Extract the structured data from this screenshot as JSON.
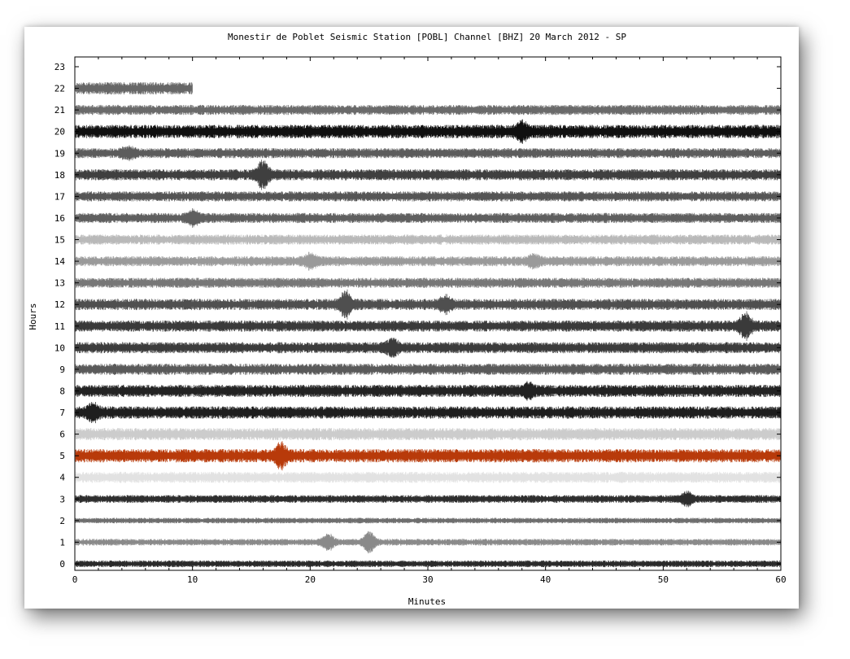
{
  "chart_data": {
    "type": "line",
    "title": "Monestir de Poblet Seismic Station [POBL] Channel [BHZ] 20 March 2012 - SP",
    "xlabel": "Minutes",
    "ylabel": "Hours",
    "xlim": [
      0,
      60
    ],
    "ylim": [
      0,
      23
    ],
    "x_ticks": [
      "0",
      "10",
      "20",
      "30",
      "40",
      "50",
      "60"
    ],
    "y_ticks": [
      "0",
      "1",
      "2",
      "3",
      "4",
      "5",
      "6",
      "7",
      "8",
      "9",
      "10",
      "11",
      "12",
      "13",
      "14",
      "15",
      "16",
      "17",
      "18",
      "19",
      "20",
      "21",
      "22",
      "23"
    ],
    "grid": false,
    "series": [
      {
        "hour": 0,
        "color": "#2a2a2a",
        "amplitude": 0.12,
        "end_minute": 60,
        "events": []
      },
      {
        "hour": 1,
        "color": "#8a8a8a",
        "amplitude": 0.12,
        "end_minute": 60,
        "events": [
          {
            "minute": 21.5,
            "strength": 0.35
          },
          {
            "minute": 25.0,
            "strength": 0.45
          }
        ]
      },
      {
        "hour": 2,
        "color": "#6e6e6e",
        "amplitude": 0.1,
        "end_minute": 60,
        "events": []
      },
      {
        "hour": 3,
        "color": "#2e2e2e",
        "amplitude": 0.14,
        "end_minute": 60,
        "events": [
          {
            "minute": 52.0,
            "strength": 0.25
          }
        ]
      },
      {
        "hour": 4,
        "color": "#e2e2e2",
        "amplitude": 0.2,
        "end_minute": 60,
        "events": []
      },
      {
        "hour": 5,
        "color": "#b83a0a",
        "amplitude": 0.24,
        "end_minute": 60,
        "events": [
          {
            "minute": 17.5,
            "strength": 0.45
          }
        ]
      },
      {
        "hour": 6,
        "color": "#cccccc",
        "amplitude": 0.22,
        "end_minute": 60,
        "events": []
      },
      {
        "hour": 7,
        "color": "#1e1e1e",
        "amplitude": 0.22,
        "end_minute": 60,
        "events": [
          {
            "minute": 1.5,
            "strength": 0.3
          }
        ]
      },
      {
        "hour": 8,
        "color": "#232323",
        "amplitude": 0.22,
        "end_minute": 60,
        "events": [
          {
            "minute": 38.5,
            "strength": 0.25
          }
        ]
      },
      {
        "hour": 9,
        "color": "#5a5a5a",
        "amplitude": 0.2,
        "end_minute": 60,
        "events": []
      },
      {
        "hour": 10,
        "color": "#3c3c3c",
        "amplitude": 0.2,
        "end_minute": 60,
        "events": [
          {
            "minute": 27.0,
            "strength": 0.3
          }
        ]
      },
      {
        "hour": 11,
        "color": "#3a3a3a",
        "amplitude": 0.2,
        "end_minute": 60,
        "events": [
          {
            "minute": 57.0,
            "strength": 0.5
          }
        ]
      },
      {
        "hour": 12,
        "color": "#4f4f4f",
        "amplitude": 0.2,
        "end_minute": 60,
        "events": [
          {
            "minute": 23.0,
            "strength": 0.55
          },
          {
            "minute": 31.5,
            "strength": 0.25
          }
        ]
      },
      {
        "hour": 13,
        "color": "#777777",
        "amplitude": 0.18,
        "end_minute": 60,
        "events": []
      },
      {
        "hour": 14,
        "color": "#9a9a9a",
        "amplitude": 0.18,
        "end_minute": 60,
        "events": [
          {
            "minute": 20.0,
            "strength": 0.25
          },
          {
            "minute": 39.0,
            "strength": 0.2
          }
        ]
      },
      {
        "hour": 15,
        "color": "#b9b9b9",
        "amplitude": 0.18,
        "end_minute": 60,
        "events": []
      },
      {
        "hour": 16,
        "color": "#5f5f5f",
        "amplitude": 0.18,
        "end_minute": 60,
        "events": [
          {
            "minute": 10.0,
            "strength": 0.25
          }
        ]
      },
      {
        "hour": 17,
        "color": "#555555",
        "amplitude": 0.18,
        "end_minute": 60,
        "events": []
      },
      {
        "hour": 18,
        "color": "#3f3f3f",
        "amplitude": 0.2,
        "end_minute": 60,
        "events": [
          {
            "minute": 16.0,
            "strength": 0.55
          }
        ]
      },
      {
        "hour": 19,
        "color": "#5c5c5c",
        "amplitude": 0.18,
        "end_minute": 60,
        "events": [
          {
            "minute": 4.5,
            "strength": 0.2
          }
        ]
      },
      {
        "hour": 20,
        "color": "#101010",
        "amplitude": 0.24,
        "end_minute": 60,
        "events": [
          {
            "minute": 38.0,
            "strength": 0.3
          }
        ]
      },
      {
        "hour": 21,
        "color": "#6a6a6a",
        "amplitude": 0.18,
        "end_minute": 60,
        "events": []
      },
      {
        "hour": 22,
        "color": "#676767",
        "amplitude": 0.22,
        "end_minute": 10,
        "events": []
      }
    ]
  }
}
